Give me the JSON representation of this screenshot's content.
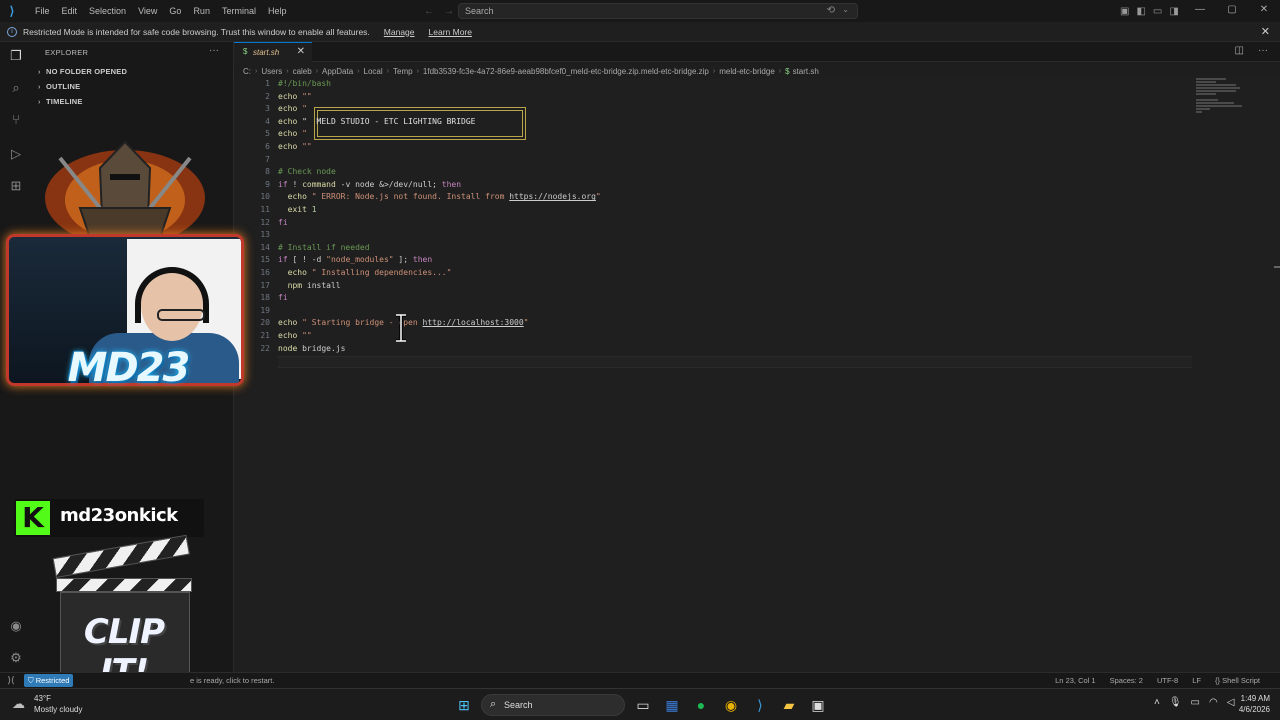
{
  "titlebar": {
    "menu": [
      "File",
      "Edit",
      "Selection",
      "View",
      "Go",
      "Run",
      "Terminal",
      "Help"
    ],
    "search_placeholder": "Search"
  },
  "banner": {
    "message": "Restricted Mode is intended for safe code browsing. Trust this window to enable all features.",
    "manage": "Manage",
    "learn_more": "Learn More"
  },
  "sidebar": {
    "title": "EXPLORER",
    "sections": [
      "NO FOLDER OPENED",
      "OUTLINE",
      "TIMELINE"
    ]
  },
  "tab": {
    "label": "start.sh"
  },
  "breadcrumb": [
    "C:",
    "Users",
    "caleb",
    "AppData",
    "Local",
    "Temp",
    "1fdb3539-fc3e-4a72-86e9-aeab98bfcef0_meld-etc-bridge.zip.meld-etc-bridge.zip",
    "meld-etc-bridge",
    "start.sh"
  ],
  "editor": {
    "line_numbers": [
      "1",
      "2",
      "3",
      "4",
      "5",
      "6",
      "7",
      "8",
      "9",
      "10",
      "11",
      "12",
      "13",
      "14",
      "15",
      "16",
      "17",
      "18",
      "19",
      "20",
      "21",
      "22"
    ],
    "lines": {
      "l1": "#!/bin/bash",
      "l2_cmd": "echo",
      "l2_str": "\"\"",
      "l3_cmd": "echo",
      "l3_str": "\"",
      "l4_cmd": "echo",
      "l4_str": "\"  MELD STUDIO - ETC LIGHTING BRIDGE",
      "l5_cmd": "echo",
      "l5_str": "\"",
      "l6_cmd": "echo",
      "l6_str": "\"\"",
      "l8": "# Check node",
      "l9_a": "if",
      "l9_b": " ! ",
      "l9_c": "command",
      "l9_d": " -v node &>/dev/null; ",
      "l9_e": "then",
      "l10_cmd": "echo",
      "l10_str": "\" ERROR: Node.js not found. Install from ",
      "l10_url": "https://nodejs.org",
      "l10_end": "\"",
      "l11_cmd": "exit",
      "l11_num": " 1",
      "l12": "fi",
      "l14": "# Install if needed",
      "l15_a": "if",
      "l15_b": " [ ! -d ",
      "l15_c": "\"node_modules\"",
      "l15_d": " ]; ",
      "l15_e": "then",
      "l16_cmd": "echo",
      "l16_str": "\" Installing dependencies...\"",
      "l17_cmd": "npm",
      "l17_rest": " install",
      "l18": "fi",
      "l20_cmd": "echo",
      "l20_str": "\" Starting bridge - open ",
      "l20_url": "http://localhost:3000",
      "l20_end": "\"",
      "l21_cmd": "echo",
      "l21_str": "\"\"",
      "l22_cmd": "node",
      "l22_rest": " bridge.js"
    }
  },
  "overlay": {
    "streamer_logo": "MD23",
    "kick_handle": "md23onkick",
    "clip_label": "CLIP IT!"
  },
  "statusbar": {
    "restricted": "Restricted",
    "ext_message": "e is ready, click to restart.",
    "position": "Ln 23, Col 1",
    "spaces": "Spaces: 2",
    "encoding": "UTF-8",
    "eol": "LF",
    "language": "Shell Script"
  },
  "taskbar": {
    "temperature": "43°F",
    "condition": "Mostly cloudy",
    "search": "Search",
    "time": "1:49 AM",
    "date": "4/6/2026"
  },
  "colors": {
    "accent": "#0078d4",
    "restricted_badge": "#2e7bb8",
    "kick_green": "#53fc18"
  }
}
